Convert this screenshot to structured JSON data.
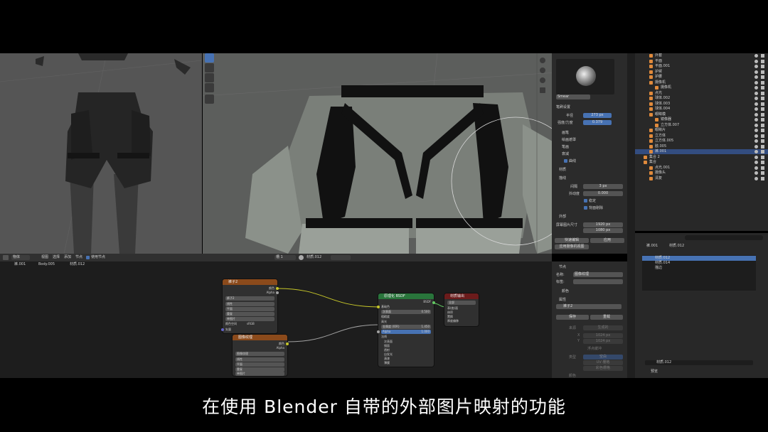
{
  "subtitle": "在使用 Blender 自带的外部图片映射的功能",
  "brush": {
    "name": "Smear",
    "settings_title": "笔刷设置",
    "radius_label": "半径",
    "radius_value": "273 px",
    "strength_label": "强度/力度",
    "strength_value": "0.379",
    "sections": [
      "画笔",
      "绘画遮罩",
      "笔画",
      "衰减",
      "曲线"
    ],
    "curve_checked": true,
    "texture_label": "材质",
    "stroke_label": "描线",
    "spacing_label": "间隔",
    "spacing_value": "3 px",
    "jitter_label": "抖动度",
    "jitter_value": "0.000",
    "smooth_label": "稳定",
    "smooth2_label": "背面剔除",
    "external_label": "外部",
    "screen_size_label": "屏幕图片尺寸",
    "size_w": "1920 px",
    "size_h": "1080 px",
    "quick_edit": "快速编辑",
    "apply": "应用",
    "apply_camera": "应用摄像机视图"
  },
  "outliner": {
    "rows": [
      {
        "label": "外套",
        "depth": 2
      },
      {
        "label": "平面",
        "depth": 2
      },
      {
        "label": "平面.001",
        "depth": 2
      },
      {
        "label": "护臂",
        "depth": 2
      },
      {
        "label": "护腰",
        "depth": 2
      },
      {
        "label": "摄像机",
        "depth": 2
      },
      {
        "label": "摄像机",
        "depth": 3
      },
      {
        "label": "点光",
        "depth": 2
      },
      {
        "label": "球体.002",
        "depth": 2
      },
      {
        "label": "球体.003",
        "depth": 2
      },
      {
        "label": "球体.004",
        "depth": 2
      },
      {
        "label": "眼睛模",
        "depth": 2
      },
      {
        "label": "镜像器",
        "depth": 3
      },
      {
        "label": "立方体.007",
        "depth": 3
      },
      {
        "label": "眼睛片",
        "depth": 2
      },
      {
        "label": "立方体",
        "depth": 2
      },
      {
        "label": "立方体.005",
        "depth": 2
      },
      {
        "label": "肢.005",
        "depth": 2
      },
      {
        "label": "裤.001",
        "depth": 2,
        "selected": true
      },
      {
        "label": "集合 2",
        "depth": 1
      },
      {
        "label": "集合",
        "depth": 1
      },
      {
        "label": "点光.001",
        "depth": 2
      },
      {
        "label": "摄像头",
        "depth": 2
      },
      {
        "label": "清复",
        "depth": 2
      }
    ]
  },
  "node_header": {
    "mode": "物体",
    "menus": [
      "视图",
      "选择",
      "添加",
      "节点"
    ],
    "use_nodes": "使用节点",
    "slot": "槽 1",
    "material": "材质.012"
  },
  "breadcrumb": [
    "裤.001",
    "Body.005",
    "材质.012"
  ],
  "nodes": {
    "tex1": {
      "title": "裤子2",
      "outputs": [
        "颜色",
        "Alpha"
      ],
      "image": "裤子2",
      "rows": [
        "线性",
        "平面",
        "重复",
        "单图片",
        "颜色空间",
        "sRGB",
        "矢量"
      ]
    },
    "tex2": {
      "title": "图像纹理",
      "outputs": [
        "颜色",
        "Alpha"
      ],
      "image": "图像纹理",
      "rows": [
        "线性",
        "平面",
        "重复",
        "单图片"
      ]
    },
    "bsdf": {
      "title": "原理化 BSDF",
      "output": "BSDF",
      "rows": [
        "基础色",
        "次表面",
        "粗糙度",
        "高光",
        "金属度 (IOR)",
        "Alpha",
        "法线",
        "次表面",
        "镜面",
        "透射",
        "自发光",
        "清漆",
        "自发光",
        "薄膜"
      ],
      "subsurface_value": "0.500",
      "ior_value": "1.450",
      "alpha_value": "1.000"
    },
    "output": {
      "title": "材质输出",
      "target": "全部",
      "inputs": [
        "表(曲)面",
        "体积",
        "置换",
        "厚度偏移"
      ]
    }
  },
  "side_panel": {
    "node_title": "节点",
    "name_label": "名称:",
    "name_value": "图像纹理",
    "label_label": "标签:",
    "color_label": "颜色",
    "props_label": "属性",
    "image": "裤子2",
    "save": "保存",
    "reload": "重载",
    "source_label": "来源",
    "source_value": "生成的",
    "x_label": "X",
    "x_value": "1024 px",
    "y_label": "Y",
    "y_value": "1024 px",
    "float": "浮点缓冲",
    "type_label": "类型",
    "type_options": [
      "空白",
      "UV 栅格",
      "彩色栅格"
    ],
    "color2": "颜色"
  },
  "mat_panel": {
    "header_left": "裤.001",
    "header_right": "材质.012",
    "slots": [
      {
        "label": "材质.012",
        "selected": true
      },
      {
        "label": "材质.014"
      },
      {
        "label": "描边"
      }
    ],
    "current": "材质.012",
    "preview": "预览"
  },
  "colors": {
    "accent": "#4772b3",
    "node_tex": "#8b4a1b",
    "node_shader": "#29753b",
    "node_output": "#6b1b1b",
    "socket_yellow": "#c7c729",
    "socket_gray": "#a1a1a1",
    "socket_purple": "#6363c7",
    "socket_green": "#63c763"
  }
}
